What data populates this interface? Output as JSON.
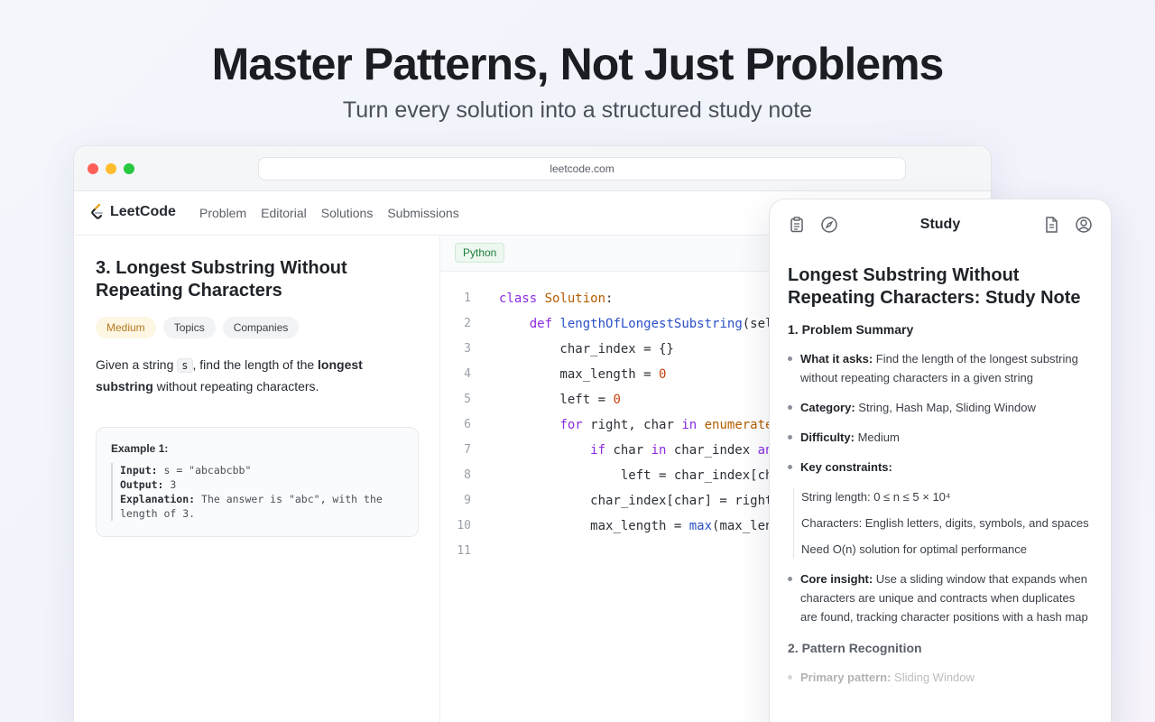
{
  "hero": {
    "title": "Master Patterns, Not Just Problems",
    "subtitle": "Turn every solution into a structured study note"
  },
  "browser": {
    "url": "leetcode.com"
  },
  "nav": {
    "logo_text": "LeetCode",
    "items": [
      "Problem",
      "Editorial",
      "Solutions",
      "Submissions"
    ]
  },
  "problem": {
    "title": "3. Longest Substring Without Repeating Characters",
    "tags": [
      "Medium",
      "Topics",
      "Companies"
    ],
    "desc_pre": "Given a string ",
    "desc_code": "s",
    "desc_mid": ", find the length of the ",
    "desc_bold": "longest substring",
    "desc_post": " without repeating characters.",
    "example_title": "Example 1:",
    "example_input_label": "Input:",
    "example_input": " s = \"abcabcbb\"",
    "example_output_label": "Output:",
    "example_output": " 3",
    "example_expl_label": "Explanation:",
    "example_expl": " The answer is \"abc\", with the length of 3."
  },
  "code": {
    "language": "Python",
    "line_numbers": [
      "1",
      "2",
      "3",
      "4",
      "5",
      "6",
      "7",
      "8",
      "9",
      "10",
      "11"
    ]
  },
  "study": {
    "header_title": "Study",
    "note_title": "Longest Substring Without Repeating Characters: Study Note",
    "section1": "1. Problem Summary",
    "what_label": "What it asks:",
    "what_text": " Find the length of the longest substring without repeating characters in a given string",
    "cat_label": "Category:",
    "cat_text": " String, Hash Map, Sliding Window",
    "diff_label": "Difficulty:",
    "diff_text": " Medium",
    "constraints_label": "Key constraints:",
    "constraints": [
      "String length: 0 ≤ n ≤ 5 × 10⁴",
      "Characters: English letters, digits, symbols, and spaces",
      "Need O(n) solution for optimal performance"
    ],
    "insight_label": "Core insight:",
    "insight_text": " Use a sliding window that expands when characters are unique and contracts when duplicates are found, tracking character positions with a hash map",
    "section2": "2. Pattern Recognition",
    "section2_next_label": "Primary pattern:",
    "section2_next_text": " Sliding Window"
  }
}
